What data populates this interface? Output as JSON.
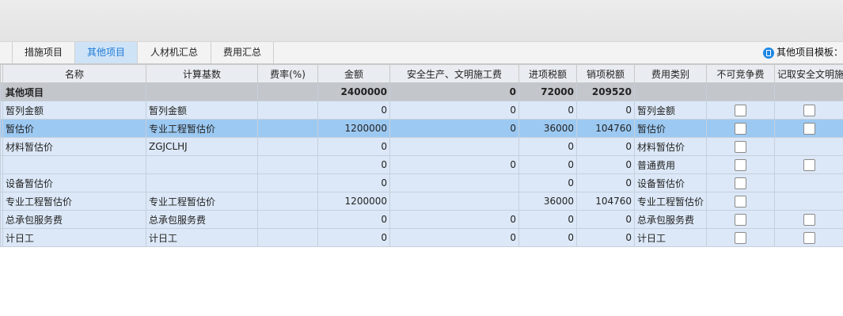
{
  "tabs": [
    {
      "label": "措施项目",
      "active": false
    },
    {
      "label": "其他项目",
      "active": true
    },
    {
      "label": "人材机汇总",
      "active": false
    },
    {
      "label": "费用汇总",
      "active": false
    }
  ],
  "template_label": "其他项目模板：",
  "columns": [
    "名称",
    "计算基数",
    "费率(%)",
    "金额",
    "安全生产、文明施工费",
    "进项税额",
    "销项税额",
    "费用类别",
    "不可竞争费",
    "记取安全文明施"
  ],
  "group_row": {
    "name": "其他项目",
    "base": "",
    "rate": "",
    "amount": "2400000",
    "safety": "0",
    "input_tax": "72000",
    "output_tax": "209520",
    "category": ""
  },
  "rows": [
    {
      "name": "暂列金额",
      "base": "暂列金额",
      "rate": "",
      "amount": "0",
      "safety": "0",
      "input_tax": "0",
      "output_tax": "0",
      "category": "暂列金额",
      "cb1": true,
      "cb2": true
    },
    {
      "name": "暂估价",
      "base": "专业工程暂估价",
      "rate": "",
      "amount": "1200000",
      "safety": "0",
      "input_tax": "36000",
      "output_tax": "104760",
      "category": "暂估价",
      "cb1": true,
      "cb2": true,
      "selected": true
    },
    {
      "name": "材料暂估价",
      "base": "ZGJCLHJ",
      "rate": "",
      "amount": "0",
      "safety": "",
      "input_tax": "0",
      "output_tax": "0",
      "category": "材料暂估价",
      "cb1": true,
      "cb2": false
    },
    {
      "name": "",
      "base": "",
      "rate": "",
      "amount": "0",
      "safety": "0",
      "input_tax": "0",
      "output_tax": "0",
      "category": "普通费用",
      "cb1": true,
      "cb2": true
    },
    {
      "name": "设备暂估价",
      "base": "",
      "rate": "",
      "amount": "0",
      "safety": "",
      "input_tax": "0",
      "output_tax": "0",
      "category": "设备暂估价",
      "cb1": true,
      "cb2": false
    },
    {
      "name": "专业工程暂估价",
      "base": "专业工程暂估价",
      "rate": "",
      "amount": "1200000",
      "safety": "",
      "input_tax": "36000",
      "output_tax": "104760",
      "category": "专业工程暂估价",
      "cb1": true,
      "cb2": false
    },
    {
      "name": "总承包服务费",
      "base": "总承包服务费",
      "rate": "",
      "amount": "0",
      "safety": "0",
      "input_tax": "0",
      "output_tax": "0",
      "category": "总承包服务费",
      "cb1": true,
      "cb2": true
    },
    {
      "name": "计日工",
      "base": "计日工",
      "rate": "",
      "amount": "0",
      "safety": "0",
      "input_tax": "0",
      "output_tax": "0",
      "category": "计日工",
      "cb1": true,
      "cb2": true
    }
  ]
}
